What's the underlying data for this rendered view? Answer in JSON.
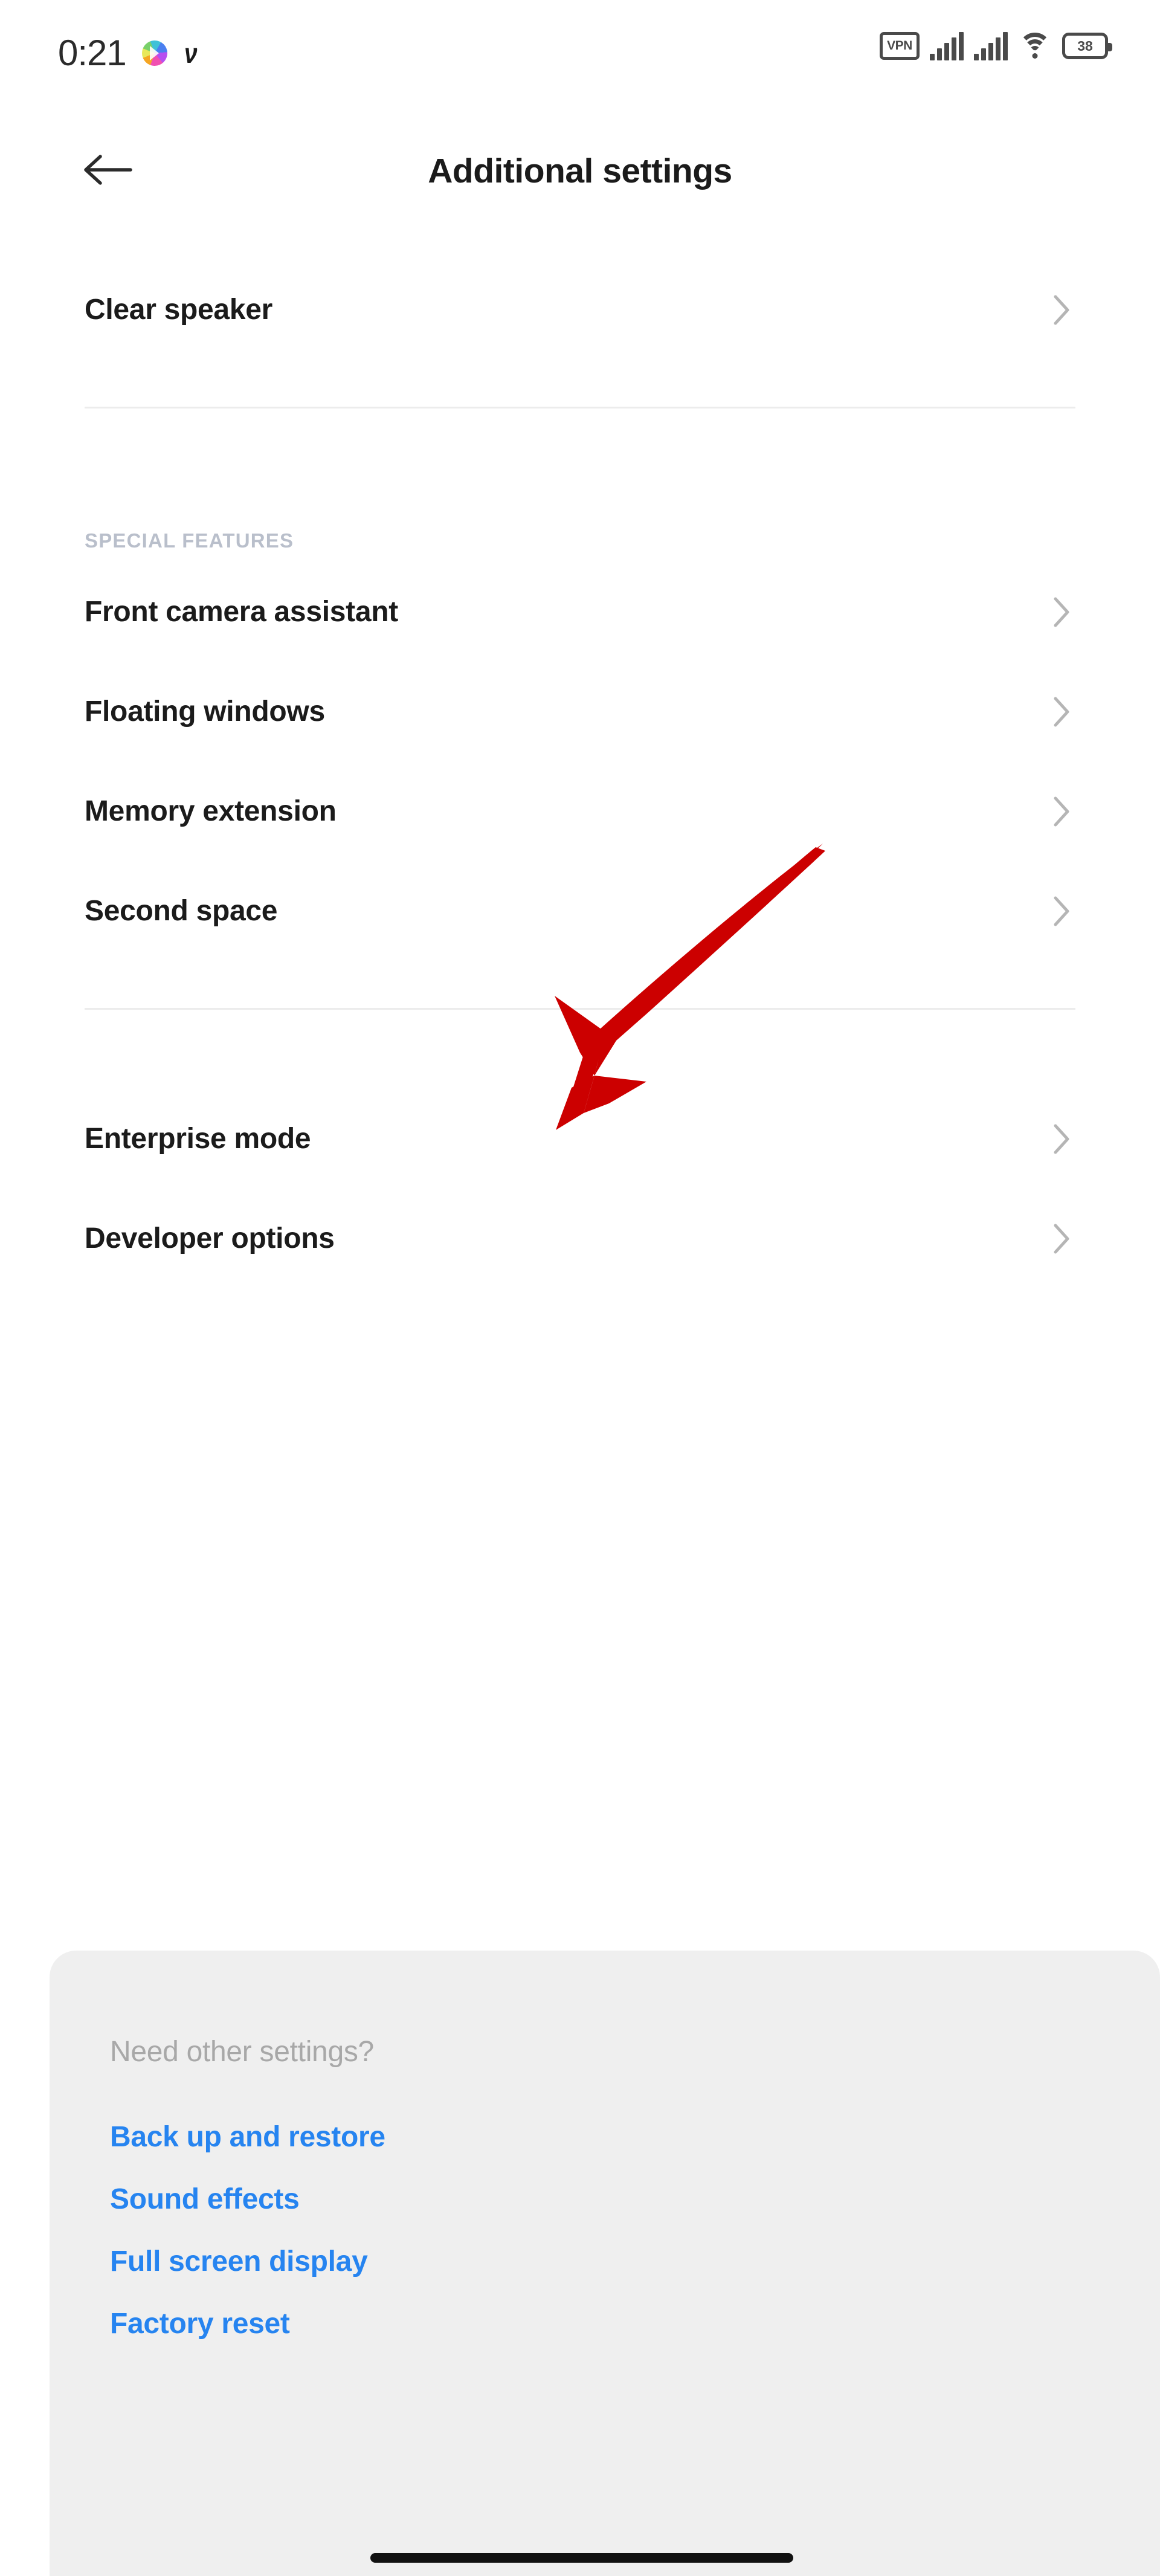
{
  "status_bar": {
    "clock": "0:21",
    "left_icons": [
      {
        "name": "color-play-icon",
        "label": ""
      },
      {
        "name": "v-app-icon",
        "label": "ν"
      }
    ],
    "vpn_label": "VPN",
    "battery_level": "38",
    "right_icons": [
      "vpn-icon",
      "signal-icon-sim1",
      "signal-icon-sim2",
      "wifi-icon",
      "battery-icon"
    ]
  },
  "header": {
    "title": "Additional settings",
    "back_label": "Back"
  },
  "list": {
    "items": [
      {
        "label": "Clear speaker",
        "type": "row"
      },
      {
        "label": "",
        "type": "divider"
      },
      {
        "label": "SPECIAL FEATURES",
        "type": "section"
      },
      {
        "label": "Front camera assistant",
        "type": "row"
      },
      {
        "label": "Floating windows",
        "type": "row"
      },
      {
        "label": "Memory extension",
        "type": "row"
      },
      {
        "label": "Second space",
        "type": "row"
      },
      {
        "label": "",
        "type": "divider"
      },
      {
        "label": "Enterprise mode",
        "type": "row"
      },
      {
        "label": "Developer options",
        "type": "row"
      }
    ]
  },
  "annotation": {
    "type": "arrow",
    "color": "#cc0000",
    "points_to": "Memory extension",
    "direction": "down-left"
  },
  "bottom_panel": {
    "heading": "Need other settings?",
    "links": [
      "Back up and restore",
      "Sound effects",
      "Full screen display",
      "Factory reset"
    ]
  },
  "colors": {
    "background": "#ffffff",
    "panel_background": "#efefef",
    "link_blue": "#2684f0",
    "section_label": "#b9bfcb",
    "primary_text": "#1b1b1b",
    "muted_text": "#a8a8a8",
    "chevron": "#b5b5b5",
    "annotation_red": "#cc0000",
    "gesture_bar": "#111111"
  }
}
